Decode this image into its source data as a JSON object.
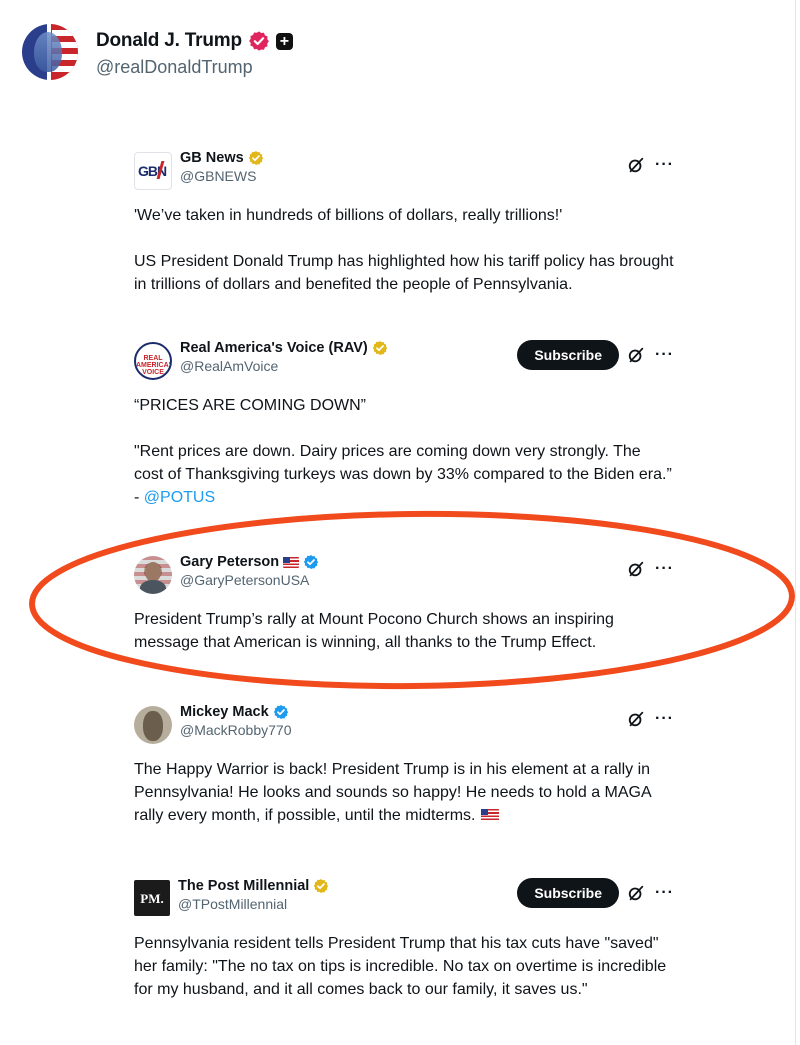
{
  "profile": {
    "name": "Donald J. Trump",
    "handle": "@realDonaldTrump",
    "plus_icon": "+"
  },
  "posts": [
    {
      "name": "GB News",
      "handle": "@GBNEWS",
      "avatar_text": "GBN",
      "badge": "gold",
      "subscribe": "",
      "paragraphs": [
        "'We’ve taken in hundreds of billions of dollars, really trillions!'",
        "US President Donald Trump has highlighted how his tariff policy has brought in trillions of dollars and benefited the people of Pennsylvania."
      ]
    },
    {
      "name": "Real America's Voice (RAV)",
      "handle": "@RealAmVoice",
      "avatar_text": "REAL AMERICA'S VOICE",
      "badge": "gold",
      "subscribe": "Subscribe",
      "paragraphs": [
        "“PRICES ARE COMING DOWN”",
        "\"Rent prices are down. Dairy prices are coming down very strongly. The cost of Thanksgiving turkeys was down by 33% compared to the Biden era.” -"
      ],
      "mention": "@POTUS"
    },
    {
      "name": "Gary Peterson",
      "handle": "@GaryPetersonUSA",
      "badge": "blue",
      "subscribe": "",
      "paragraphs": [
        "President Trump’s rally at Mount Pocono Church shows an inspiring message that American is winning, all thanks to the Trump Effect."
      ]
    },
    {
      "name": "Mickey Mack",
      "handle": "@MackRobby770",
      "badge": "blue",
      "subscribe": "",
      "paragraphs": [
        "The Happy Warrior is back! President Trump is in his element at a rally in Pennsylvania! He looks and sounds so happy! He needs to hold a MAGA rally every month, if possible, until the midterms."
      ]
    },
    {
      "name": "The Post Millennial",
      "handle": "@TPostMillennial",
      "avatar_text": "PM.",
      "badge": "gold",
      "subscribe": "Subscribe",
      "paragraphs": [
        "Pennsylvania resident tells President Trump that his tax cuts have \"saved\" her family: \"The no tax on tips is incredible. No tax on overtime is incredible for my husband, and it all comes back to our family, it saves us.\""
      ]
    }
  ],
  "more_label": "···",
  "colors": {
    "highlight_ellipse": "#f04a1d",
    "verified_blue": "#1d9bf0",
    "verified_gold": "#e2b719",
    "verified_pink": "#e0245e"
  }
}
